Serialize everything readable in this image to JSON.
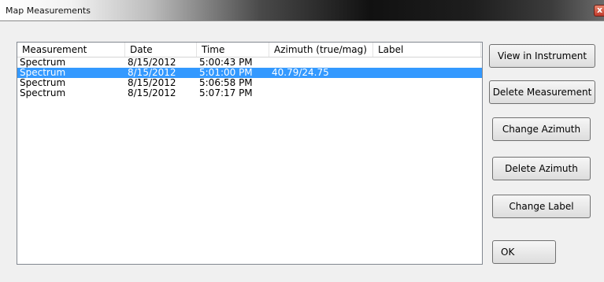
{
  "window": {
    "title": "Map Measurements",
    "close_glyph": "x"
  },
  "list": {
    "columns": [
      "Measurement",
      "Date",
      "Time",
      "Azimuth (true/mag)",
      "Label"
    ],
    "rows": [
      {
        "measurement": "Spectrum",
        "date": "8/15/2012",
        "time": "5:00:43 PM",
        "azimuth": "",
        "label": "",
        "selected": false
      },
      {
        "measurement": "Spectrum",
        "date": "8/15/2012",
        "time": "5:01:00 PM",
        "azimuth": "40.79/24.75",
        "label": "",
        "selected": true
      },
      {
        "measurement": "Spectrum",
        "date": "8/15/2012",
        "time": "5:06:58 PM",
        "azimuth": "",
        "label": "",
        "selected": false
      },
      {
        "measurement": "Spectrum",
        "date": "8/15/2012",
        "time": "5:07:17 PM",
        "azimuth": "",
        "label": "",
        "selected": false
      }
    ]
  },
  "buttons": {
    "view_in_instrument": "View in Instrument",
    "delete_measurement": "Delete Measurement",
    "change_azimuth": "Change Azimuth",
    "delete_azimuth": "Delete Azimuth",
    "change_label": "Change Label",
    "ok": "OK"
  },
  "colors": {
    "selection": "#3399ff",
    "background": "#f0f0f0"
  }
}
